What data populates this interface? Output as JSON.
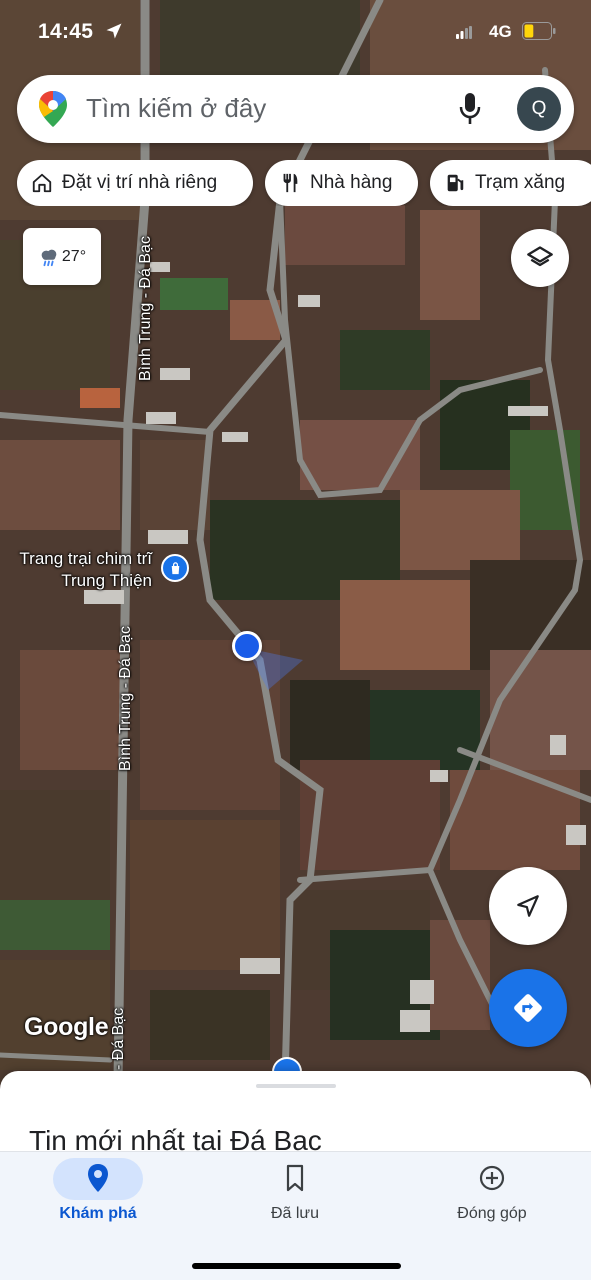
{
  "status_bar": {
    "time": "14:45",
    "network": "4G",
    "battery_level": 0.35,
    "battery_color": "#ffd60a"
  },
  "search": {
    "placeholder": "Tìm kiếm ở đây",
    "avatar_initial": "Q"
  },
  "chips": [
    {
      "label": "Đặt vị trí nhà riêng",
      "icon": "home-icon"
    },
    {
      "label": "Nhà hàng",
      "icon": "restaurant-icon"
    },
    {
      "label": "Trạm xăng",
      "icon": "gas-station-icon"
    }
  ],
  "weather": {
    "temperature": "27°",
    "icon": "rain-cloud-icon"
  },
  "map": {
    "road_labels": [
      "Bình Trung - Đá Bạc",
      "Bình Trung - Đá Bạc",
      "- Đá Bạc"
    ],
    "poi_name": "Trang trại chim trĩ Trung Thiện",
    "logo": "Google"
  },
  "bottom_sheet": {
    "title": "Tin mới nhất tại Đá Bạc"
  },
  "bottom_nav": [
    {
      "label": "Khám phá",
      "icon": "explore-pin-icon",
      "active": true
    },
    {
      "label": "Đã lưu",
      "icon": "bookmark-icon",
      "active": false
    },
    {
      "label": "Đóng góp",
      "icon": "add-circle-icon",
      "active": false
    }
  ],
  "colors": {
    "accent": "#1a73e8",
    "nav_active": "#0b57d0",
    "nav_pill": "#d3e3fd"
  }
}
